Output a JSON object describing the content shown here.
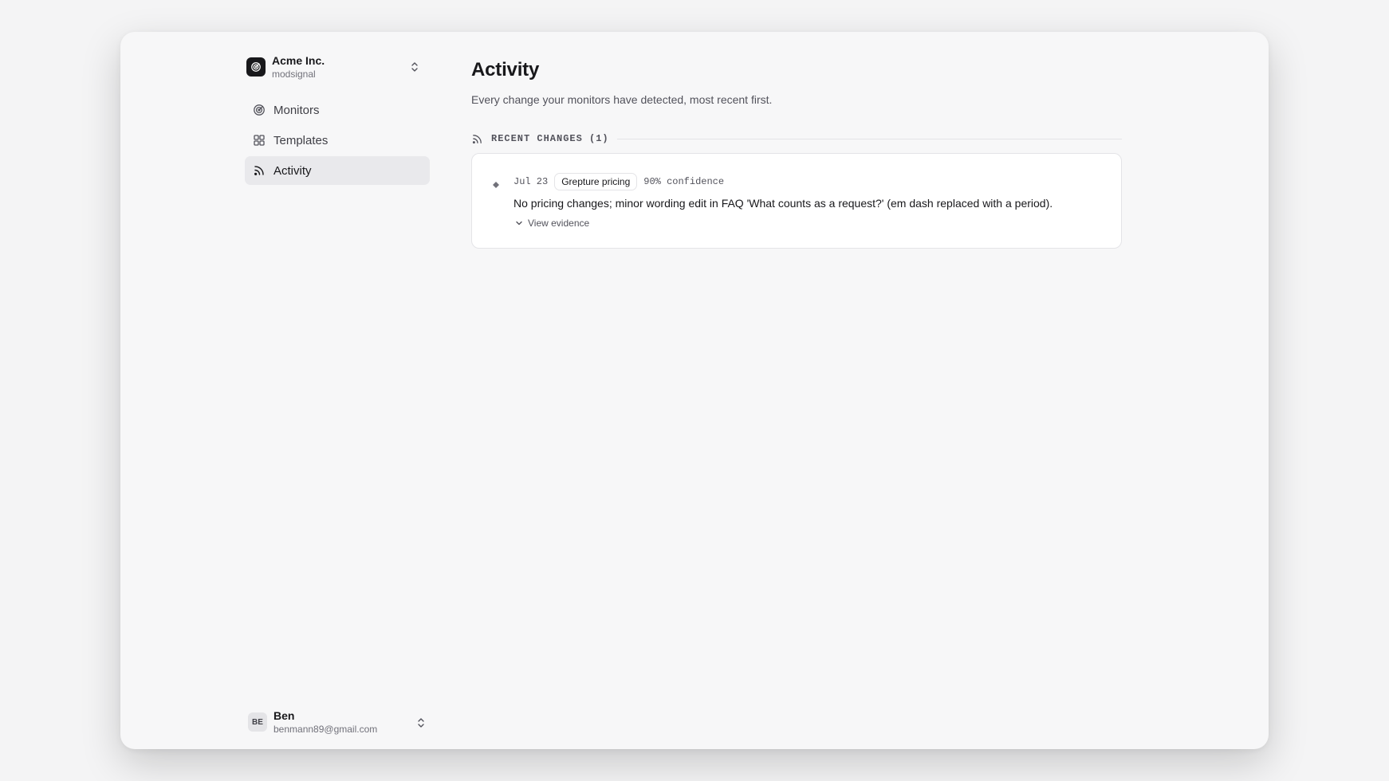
{
  "org": {
    "name": "Acme Inc.",
    "slug": "modsignal"
  },
  "nav": {
    "items": [
      {
        "label": "Monitors",
        "icon": "radar-icon"
      },
      {
        "label": "Templates",
        "icon": "grid-icon"
      },
      {
        "label": "Activity",
        "icon": "rss-icon",
        "active": true
      }
    ]
  },
  "user": {
    "initials": "BE",
    "name": "Ben",
    "email": "benmann89@gmail.com"
  },
  "page": {
    "title": "Activity",
    "subtitle": "Every change your monitors have detected, most recent first."
  },
  "section": {
    "label": "RECENT CHANGES (1)"
  },
  "changes": [
    {
      "date": "Jul 23",
      "monitor": "Grepture pricing",
      "confidence": "90% confidence",
      "summary": "No pricing changes; minor wording edit in FAQ 'What counts as a request?' (em dash replaced with a period).",
      "evidence_label": "View evidence"
    }
  ],
  "colors": {
    "accent": "#18181b",
    "muted": "#71717a",
    "border": "#e4e4e7",
    "active_bg": "#e9e9ec"
  }
}
